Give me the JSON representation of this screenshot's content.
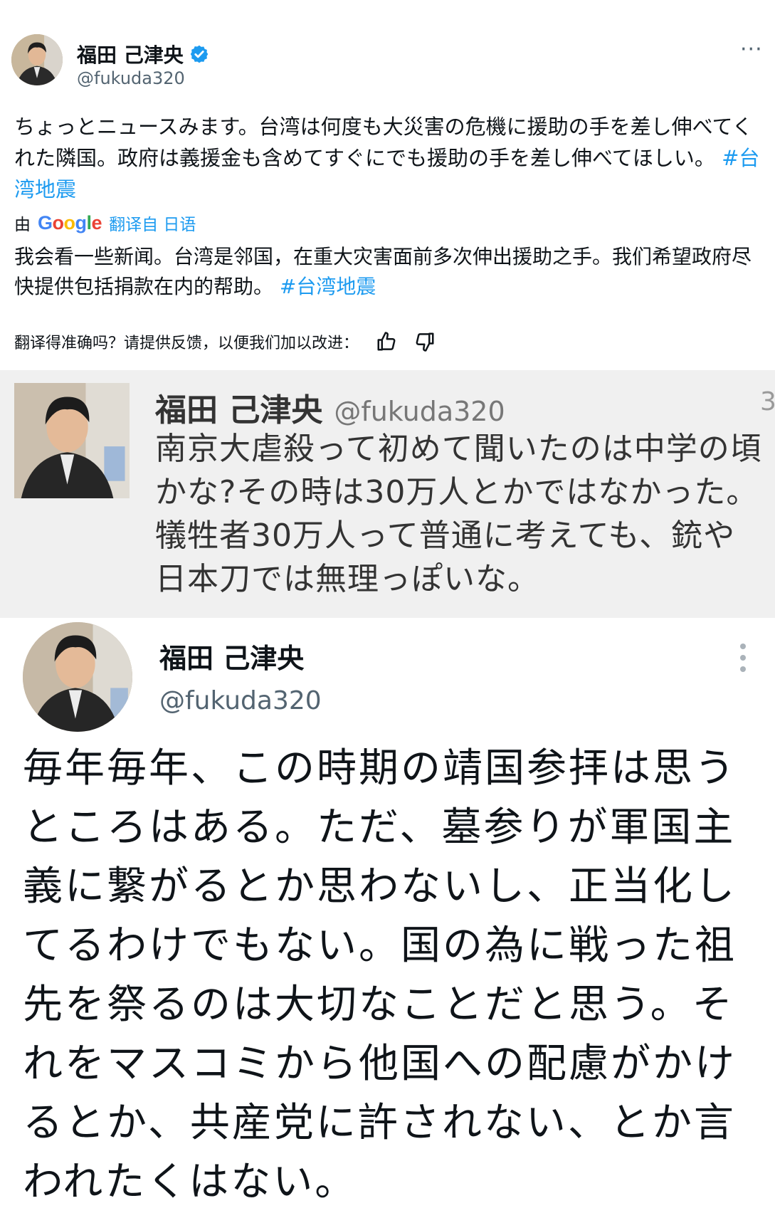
{
  "tweet1": {
    "display_name": "福田 己津央",
    "handle": "@fukuda320",
    "more_label": "···",
    "text": "ちょっとニュースみます。台湾は何度も大災害の危機に援助の手を差し伸べてくれた隣国。政府は義援金も含めてすぐにでも援助の手を差し伸べてほしい。",
    "hashtag": "#台湾地震",
    "translator_prefix": "由",
    "translator_brand": "Google",
    "translated_from": "翻译自 日语",
    "translation_text": "我会看一些新闻。台湾是邻国，在重大灾害面前多次伸出援助之手。我们希望政府尽快提供包括捐款在内的帮助。",
    "translation_hashtag": "#台湾地震",
    "feedback_prompt": "翻译得准确吗？请提供反馈，以便我们加以改进："
  },
  "tweet2": {
    "display_name": "福田 己津央",
    "handle": "@fukuda320",
    "edge_text": "3",
    "text": "南京大虐殺って初めて聞いたのは中学の頃かな?その時は30万人とかではなかった。犠牲者30万人って普通に考えても、銃や日本刀では無理っぽいな。"
  },
  "tweet3": {
    "display_name": "福田 己津央",
    "handle": "@fukuda320",
    "text": "毎年毎年、この時期の靖国参拝は思うところはある。ただ、墓参りが軍国主義に繋がるとか思わないし、正当化してるわけでもない。国の為に戦った祖先を祭るのは大切なことだと思う。それをマスコミから他国への配慮がかけるとか、共産党に許されない、とか言われたくはない。"
  },
  "colors": {
    "link": "#1d9bf0",
    "verified": "#1d9bf0",
    "secondary_text": "#536471",
    "screenshot_bg": "#f0f0f0"
  },
  "icons": [
    "verified-badge-icon",
    "more-options-icon",
    "thumbs-up-icon",
    "thumbs-down-icon",
    "vertical-more-icon"
  ]
}
